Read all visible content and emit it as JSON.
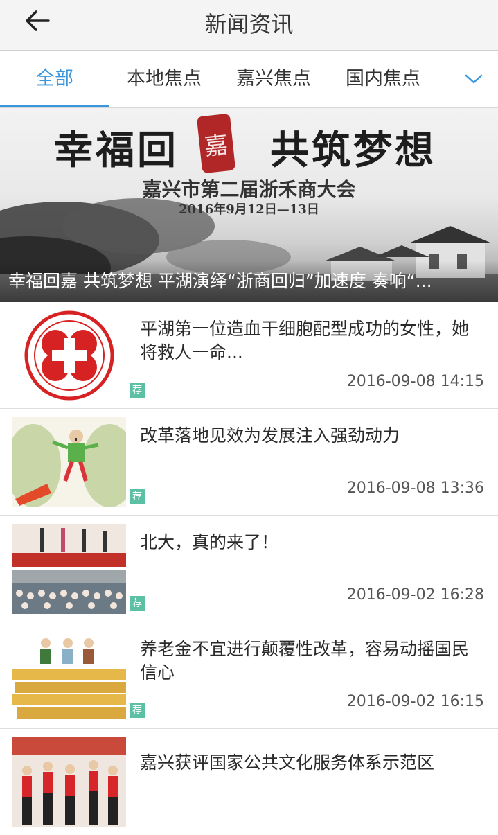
{
  "header": {
    "title": "新闻资讯",
    "back_icon": "arrow-left-icon"
  },
  "tabs": [
    {
      "label": "全部",
      "active": true
    },
    {
      "label": "本地焦点",
      "active": false
    },
    {
      "label": "嘉兴焦点",
      "active": false
    },
    {
      "label": "国内焦点",
      "active": false
    }
  ],
  "tabs_more_icon": "chevron-down-icon",
  "colors": {
    "accent": "#3a96dc",
    "tag": "#5cc0a4"
  },
  "banner": {
    "headline_left": "幸福回",
    "seal_char": "嘉",
    "headline_right": "共筑梦想",
    "subtitle": "嘉兴市第二届浙禾商大会",
    "date": "2016年9月12日—13日",
    "caption": "幸福回嘉 共筑梦想 平湖演绎“浙商回归”加速度 奏响“..."
  },
  "news": [
    {
      "title": "平湖第一位造血干细胞配型成功的女性，她将救人一命...",
      "time": "2016-09-08 14:15",
      "tag": "荐"
    },
    {
      "title": "改革落地见效为发展注入强劲动力",
      "time": "2016-09-08 13:36",
      "tag": "荐"
    },
    {
      "title": "北大，真的来了！",
      "time": "2016-09-02 16:28",
      "tag": "荐"
    },
    {
      "title": "养老金不宜进行颠覆性改革，容易动摇国民信心",
      "time": "2016-09-02 16:15",
      "tag": "荐"
    },
    {
      "title": "嘉兴获评国家公共文化服务体系示范区",
      "time": "",
      "tag": ""
    }
  ]
}
